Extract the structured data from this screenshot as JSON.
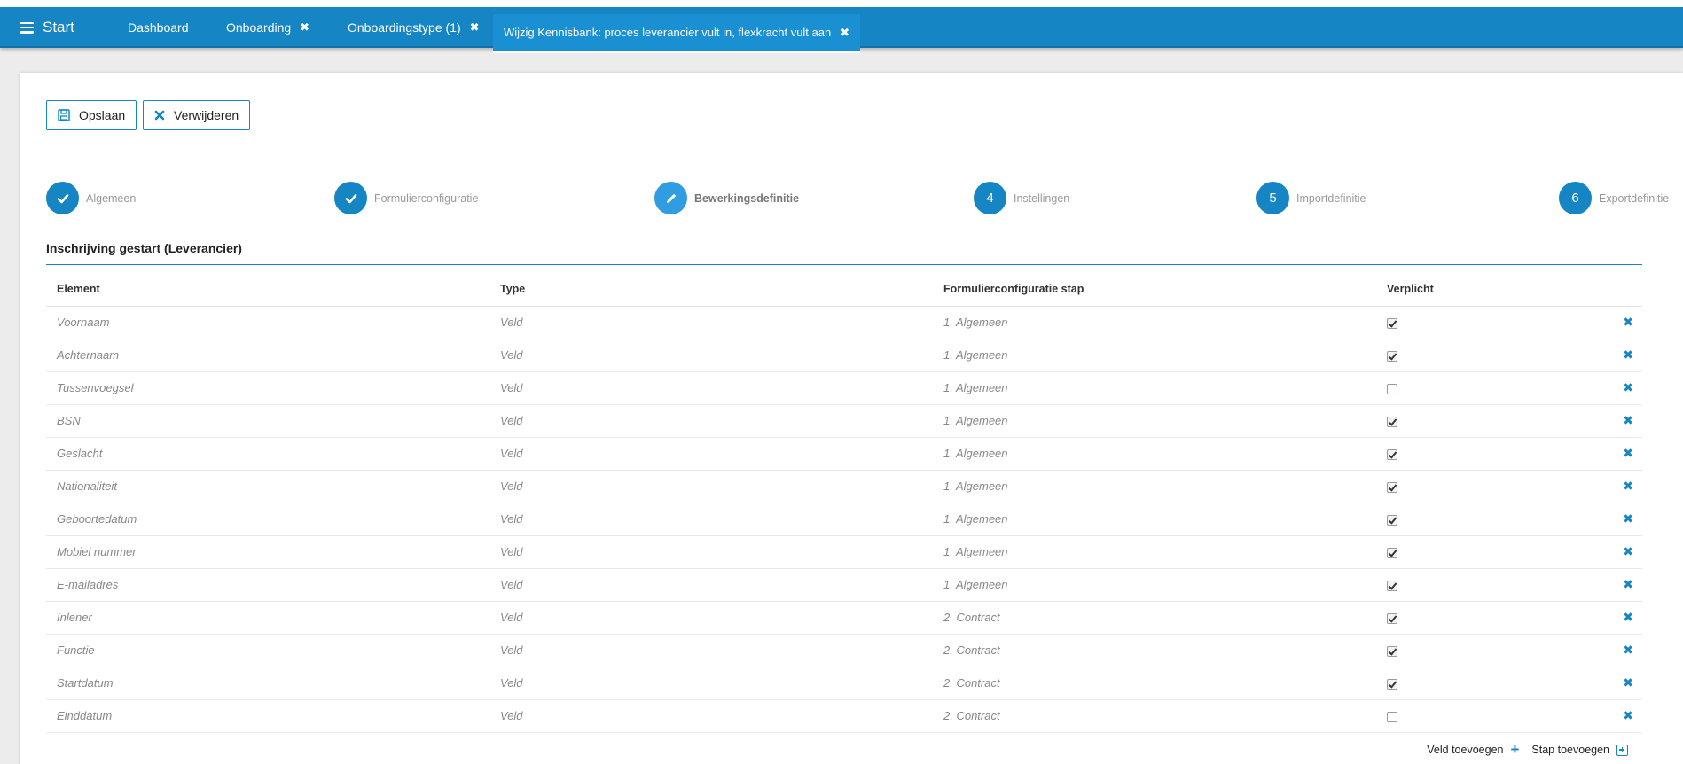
{
  "nav": {
    "start_label": "Start",
    "tabs": [
      {
        "label": "Dashboard",
        "closable": false
      },
      {
        "label": "Onboarding",
        "closable": true
      },
      {
        "label": "Onboardingstype (1)",
        "closable": true
      },
      {
        "label": "Wijzig Kennisbank: proces leverancier vult in, flexkracht vult aan",
        "closable": true,
        "active": true
      }
    ],
    "close_glyph": "✖"
  },
  "toolbar": {
    "save_label": "Opslaan",
    "delete_label": "Verwijderen"
  },
  "stepper": {
    "steps": [
      {
        "label": "Algemeen",
        "state": "done",
        "marker": "check"
      },
      {
        "label": "Formulierconfiguratie",
        "state": "done",
        "marker": "check"
      },
      {
        "label": "Bewerkingsdefinitie",
        "state": "current",
        "marker": "pencil"
      },
      {
        "label": "Instellingen",
        "state": "todo",
        "marker": "4"
      },
      {
        "label": "Importdefinitie",
        "state": "todo",
        "marker": "5"
      },
      {
        "label": "Exportdefinitie",
        "state": "todo",
        "marker": "6"
      }
    ]
  },
  "section": {
    "title": "Inschrijving gestart (Leverancier)"
  },
  "table": {
    "columns": [
      "Element",
      "Type",
      "Formulierconfiguratie stap",
      "Verplicht"
    ],
    "rows": [
      {
        "element": "Voornaam",
        "type": "Veld",
        "step": "1. Algemeen",
        "required": true
      },
      {
        "element": "Achternaam",
        "type": "Veld",
        "step": "1. Algemeen",
        "required": true
      },
      {
        "element": "Tussenvoegsel",
        "type": "Veld",
        "step": "1. Algemeen",
        "required": false
      },
      {
        "element": "BSN",
        "type": "Veld",
        "step": "1. Algemeen",
        "required": true
      },
      {
        "element": "Geslacht",
        "type": "Veld",
        "step": "1. Algemeen",
        "required": true
      },
      {
        "element": "Nationaliteit",
        "type": "Veld",
        "step": "1. Algemeen",
        "required": true
      },
      {
        "element": "Geboortedatum",
        "type": "Veld",
        "step": "1. Algemeen",
        "required": true
      },
      {
        "element": "Mobiel nummer",
        "type": "Veld",
        "step": "1. Algemeen",
        "required": true
      },
      {
        "element": "E-mailadres",
        "type": "Veld",
        "step": "1. Algemeen",
        "required": true
      },
      {
        "element": "Inlener",
        "type": "Veld",
        "step": "2. Contract",
        "required": true
      },
      {
        "element": "Functie",
        "type": "Veld",
        "step": "2. Contract",
        "required": true
      },
      {
        "element": "Startdatum",
        "type": "Veld",
        "step": "2. Contract",
        "required": true
      },
      {
        "element": "Einddatum",
        "type": "Veld",
        "step": "2. Contract",
        "required": false
      }
    ]
  },
  "footer": {
    "add_field_label": "Veld toevoegen",
    "add_step_label": "Stap toevoegen"
  },
  "colors": {
    "brand": "#1585c4",
    "background": "#ececec"
  },
  "icons": {
    "save": "floppy-disk-icon",
    "delete": "close-icon",
    "row_delete": "close-icon",
    "add_field": "plus-icon",
    "add_step": "plus-square-icon"
  }
}
